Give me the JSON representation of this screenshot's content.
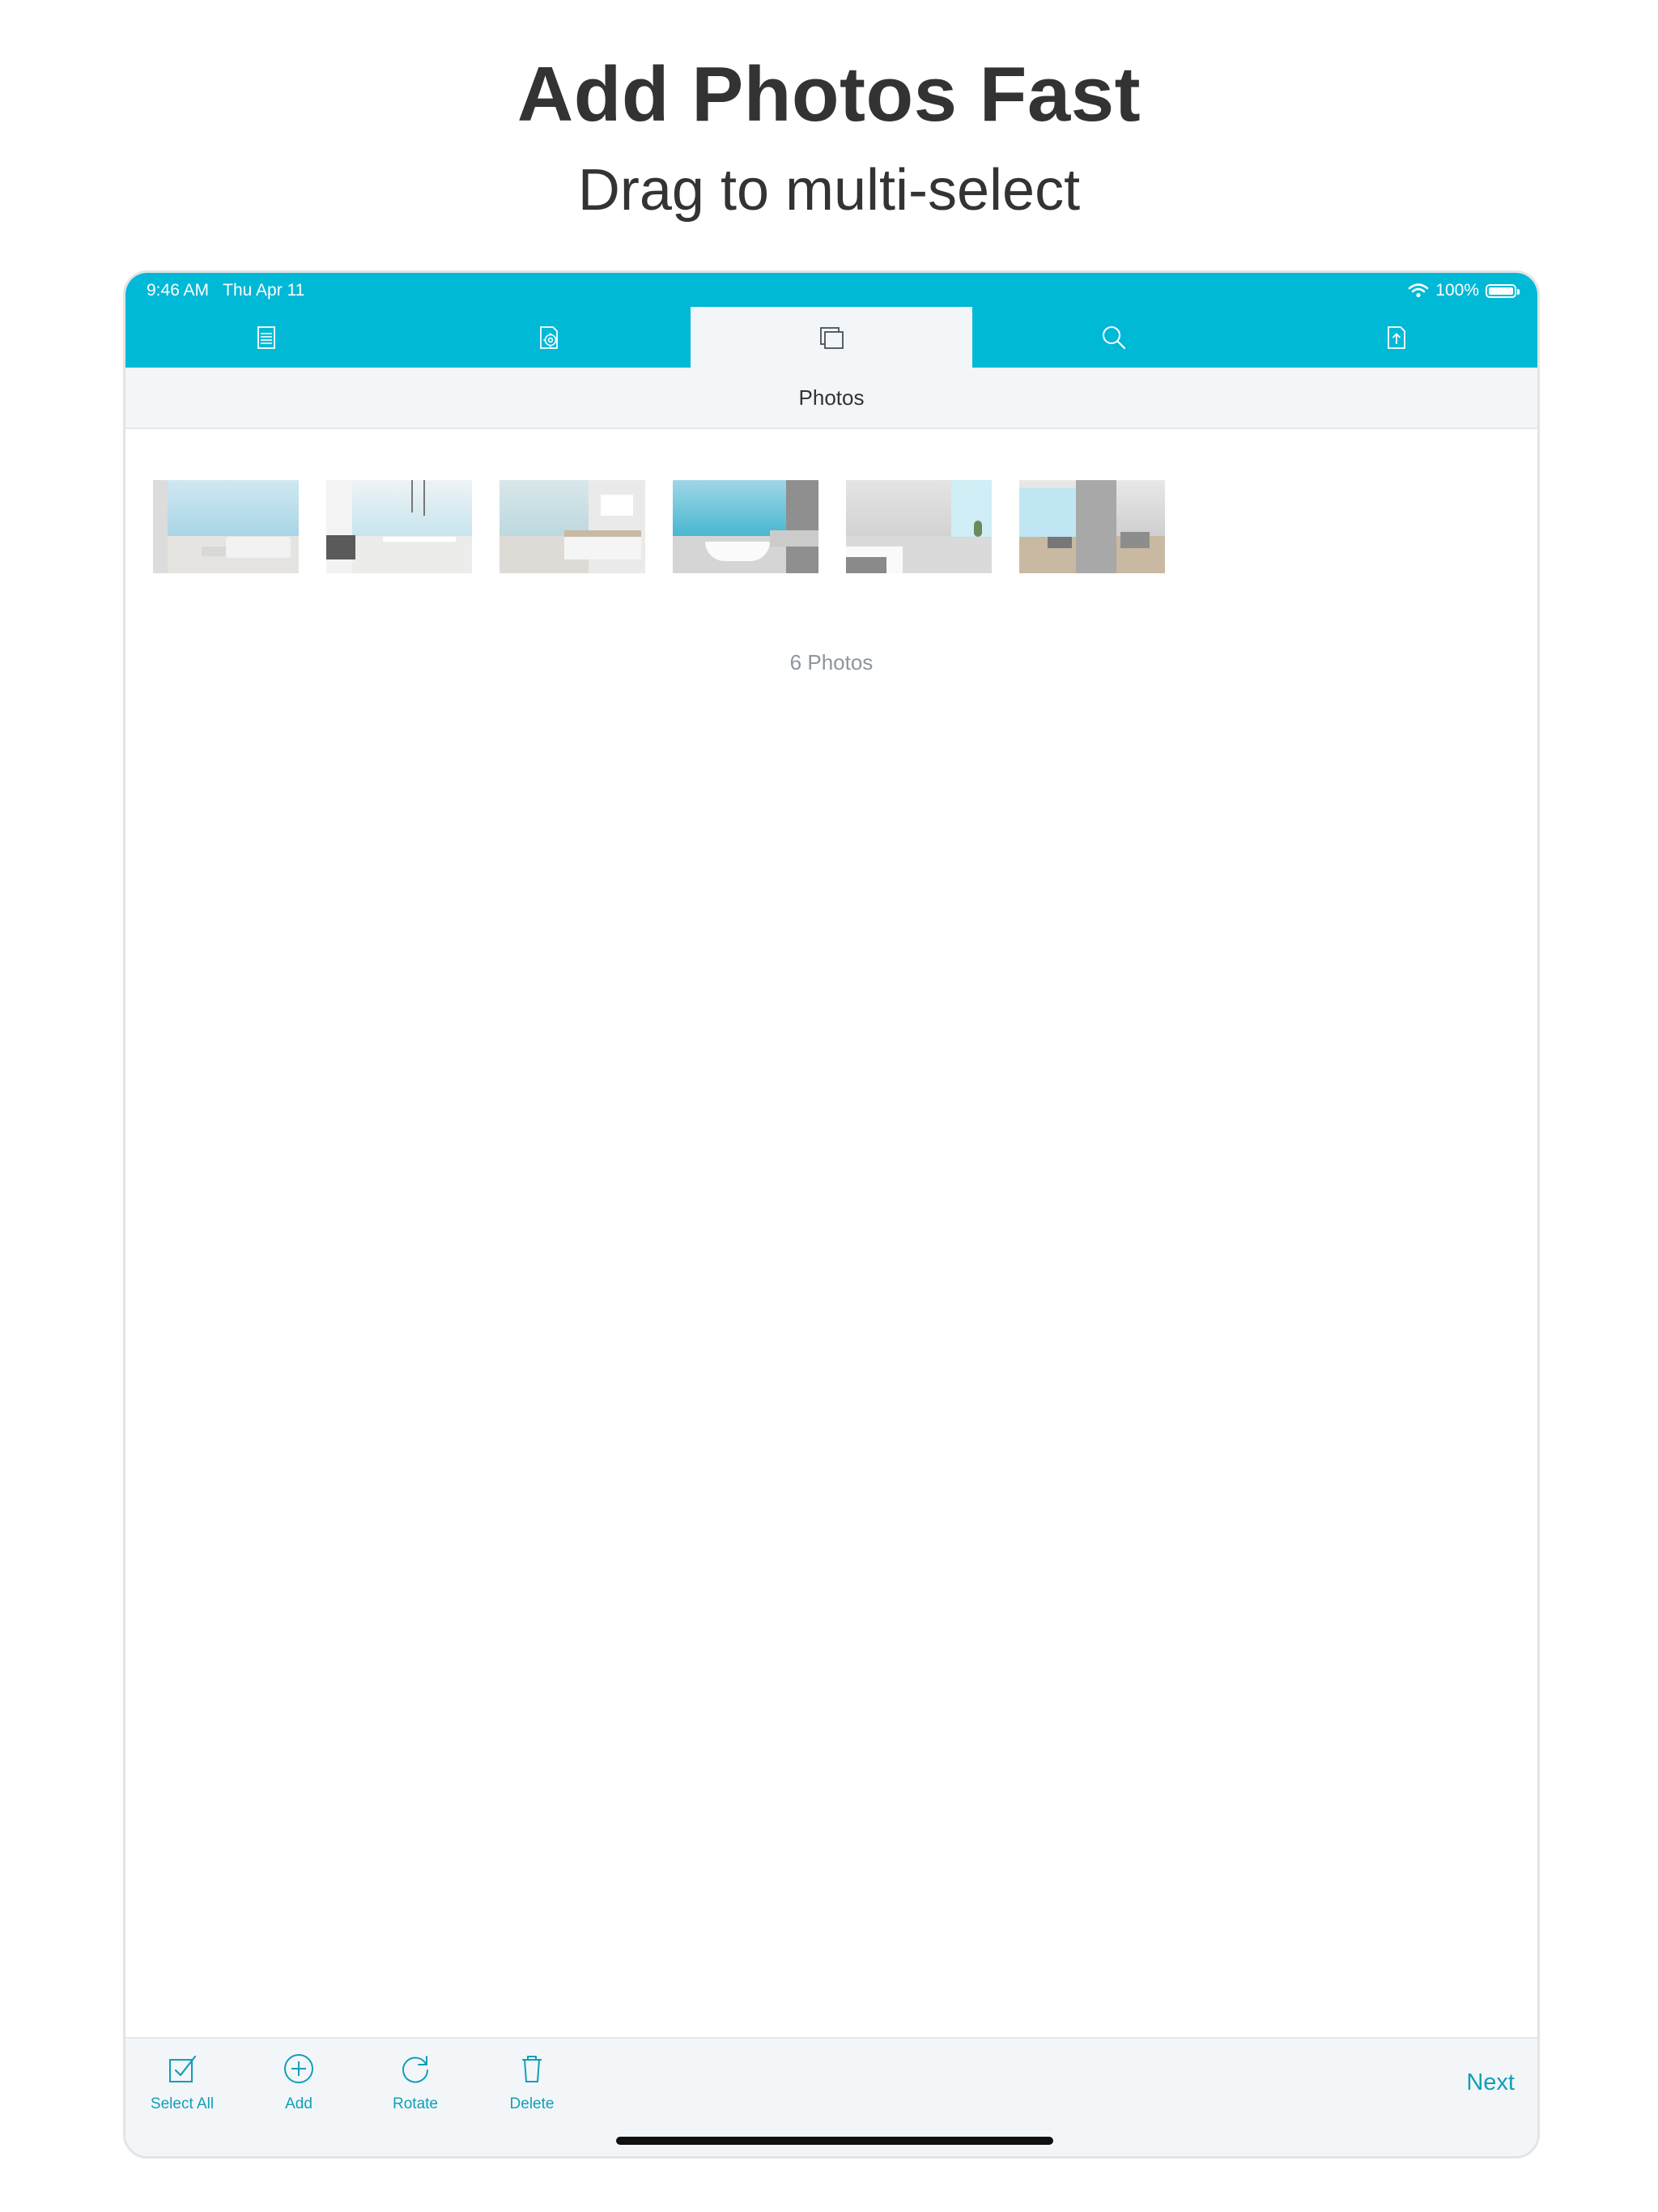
{
  "promo": {
    "title": "Add Photos Fast",
    "subtitle": "Drag to multi-select"
  },
  "status_bar": {
    "time": "9:46 AM   Thu Apr 11",
    "battery": "100%",
    "battery_level": 1.0
  },
  "tabs": [
    {
      "icon": "document-icon",
      "active": false
    },
    {
      "icon": "settings-document-icon",
      "active": false
    },
    {
      "icon": "photos-icon",
      "active": true
    },
    {
      "icon": "search-icon",
      "active": false
    },
    {
      "icon": "export-icon",
      "active": false
    }
  ],
  "header": {
    "title": "Photos"
  },
  "photos": [
    {
      "name": "living-room"
    },
    {
      "name": "dining-room"
    },
    {
      "name": "bedroom"
    },
    {
      "name": "bathroom"
    },
    {
      "name": "bedroom-2"
    },
    {
      "name": "lounge"
    }
  ],
  "photo_count": "6 Photos",
  "toolbar": {
    "select_all": "Select All",
    "add": "Add",
    "rotate": "Rotate",
    "delete": "Delete",
    "next": "Next"
  },
  "colors": {
    "accent": "#00b9d6",
    "action_text": "#109fb8",
    "panel": "#f3f6f8"
  }
}
